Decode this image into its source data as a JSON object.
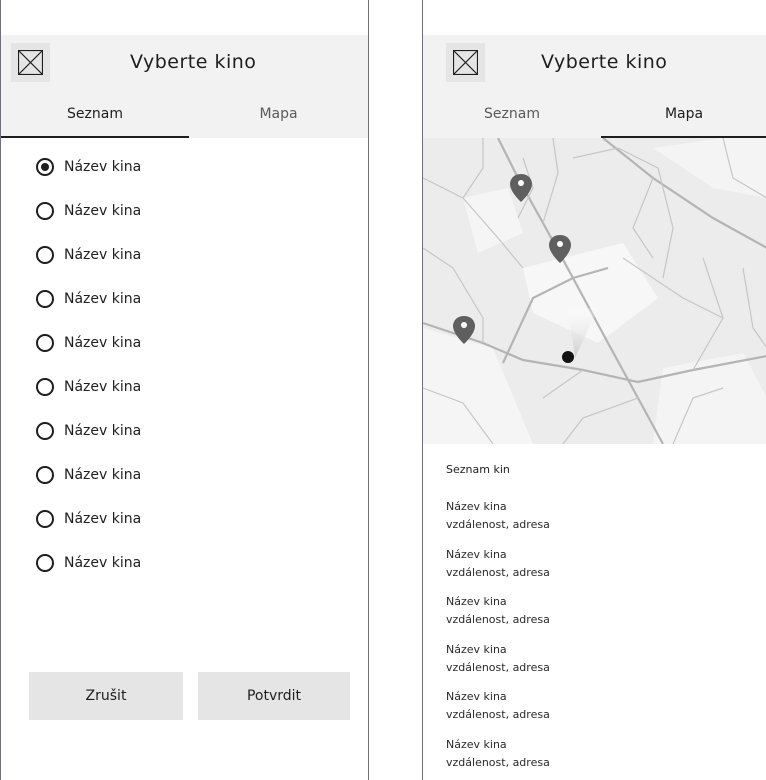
{
  "list_screen": {
    "title": "Vyberte kino",
    "tabs": [
      "Seznam",
      "Mapa"
    ],
    "active_tab": "Seznam",
    "cinemas": [
      {
        "label": "Název kina",
        "selected": true
      },
      {
        "label": "Název kina",
        "selected": false
      },
      {
        "label": "Název kina",
        "selected": false
      },
      {
        "label": "Název kina",
        "selected": false
      },
      {
        "label": "Název kina",
        "selected": false
      },
      {
        "label": "Název kina",
        "selected": false
      },
      {
        "label": "Název kina",
        "selected": false
      },
      {
        "label": "Název kina",
        "selected": false
      },
      {
        "label": "Název kina",
        "selected": false
      },
      {
        "label": "Název kina",
        "selected": false
      }
    ],
    "cancel_label": "Zrušit",
    "confirm_label": "Potvrdit"
  },
  "map_screen": {
    "title": "Vyberte kino",
    "tabs": [
      "Seznam",
      "Mapa"
    ],
    "active_tab": "Mapa",
    "section_title": "Seznam kin",
    "cinemas": [
      {
        "name": "Název kina",
        "detail": "vzdálenost, adresa"
      },
      {
        "name": "Název kina",
        "detail": "vzdálenost, adresa"
      },
      {
        "name": "Název kina",
        "detail": "vzdálenost, adresa"
      },
      {
        "name": "Název kina",
        "detail": "vzdálenost, adresa"
      },
      {
        "name": "Název kina",
        "detail": "vzdálenost, adresa"
      },
      {
        "name": "Název kina",
        "detail": "vzdálenost, adresa"
      }
    ]
  },
  "colors": {
    "text": "#1e1e1e",
    "header_bg": "#f2f2f2",
    "button_bg": "#e5e5e5",
    "map_bg": "#ececec",
    "road": "#b4b4b4",
    "pin": "#5f5f5f"
  },
  "icons": {
    "header": "image-placeholder-icon",
    "pin": "map-pin-icon",
    "user_location": "user-location-icon"
  }
}
